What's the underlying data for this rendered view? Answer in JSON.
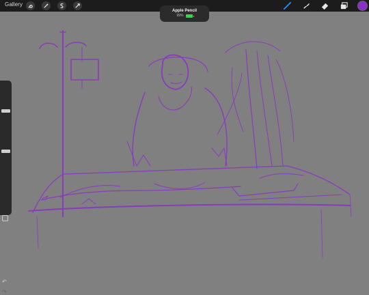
{
  "topbar": {
    "gallery_label": "Gallery",
    "left_tools": [
      "wrench-icon",
      "magic-wand-icon",
      "selection-icon",
      "transform-icon"
    ],
    "right_tools": [
      "brush-icon",
      "smudge-icon",
      "eraser-icon",
      "layers-icon"
    ],
    "current_color": "#8b2fc9"
  },
  "toast": {
    "title": "Apple Pencil",
    "percent": "99%"
  },
  "sidebar": {
    "size_slider_label": "",
    "undo_icon": "undo-icon",
    "redo_icon": "redo-icon"
  },
  "canvas": {
    "background": "#808080",
    "stroke_color": "#8b2fc9"
  }
}
